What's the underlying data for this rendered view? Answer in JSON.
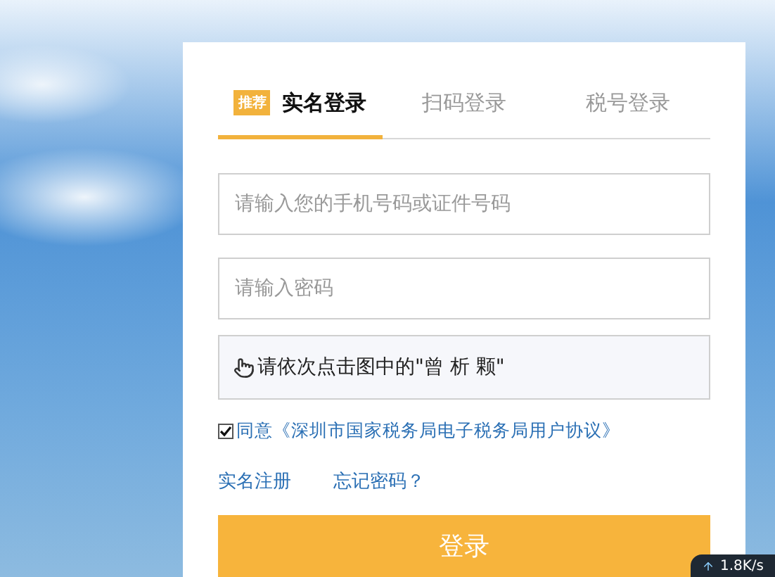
{
  "tabs": [
    {
      "badge": "推荐",
      "label": "实名登录",
      "selected": true
    },
    {
      "label": "扫码登录",
      "selected": false
    },
    {
      "label": "税号登录",
      "selected": false
    }
  ],
  "fields": [
    {
      "placeholder": "请输入您的手机号码或证件号码"
    },
    {
      "placeholder": "请输入密码"
    }
  ],
  "captcha": {
    "text": "请依次点击图中的\"曾 析 颗\""
  },
  "agreement": {
    "checked": true,
    "label": "同意《深圳市国家税务局电子税务局用户协议》"
  },
  "links": [
    "实名注册",
    "忘记密码？"
  ],
  "login_button": "登录",
  "speed_indicator": {
    "text": "1.8K/s"
  }
}
